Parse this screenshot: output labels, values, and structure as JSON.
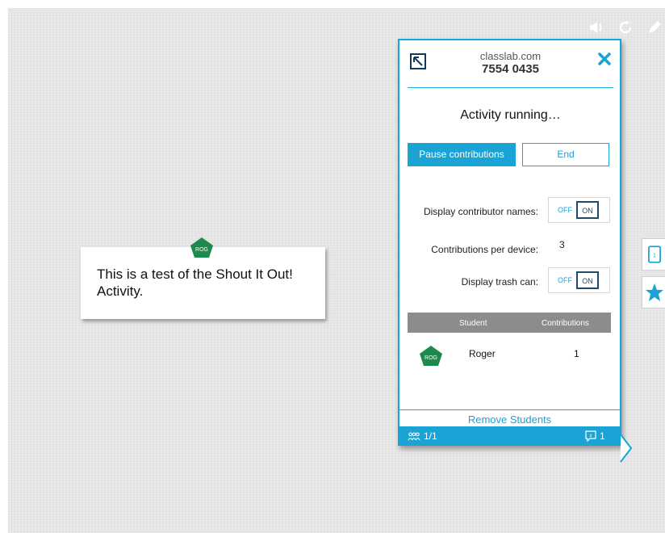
{
  "panel": {
    "domain": "classlab.com",
    "code": "7554 0435",
    "status": "Activity running…",
    "pause_label": "Pause contributions",
    "end_label": "End",
    "display_names_label": "Display contributor names:",
    "contributions_per_device_label": "Contributions per device:",
    "contributions_per_device_value": "3",
    "display_trash_label": "Display trash can:",
    "toggle_off": "OFF",
    "toggle_on": "ON",
    "table": {
      "headers": [
        "Student",
        "Contributions"
      ],
      "rows": [
        {
          "badge": "ROG",
          "name": "Roger",
          "contributions": "1"
        }
      ]
    },
    "remove_label": "Remove Students",
    "footer": {
      "participants": "1/1",
      "contributions": "1"
    }
  },
  "note": {
    "badge": "ROG",
    "text": "This is a test of the Shout It Out! Activity."
  },
  "side_tools": {
    "device_label": "1"
  },
  "colors": {
    "accent": "#1aa3d5",
    "badge_green": "#1b8a4a",
    "dark_navy": "#1f4a6a"
  }
}
